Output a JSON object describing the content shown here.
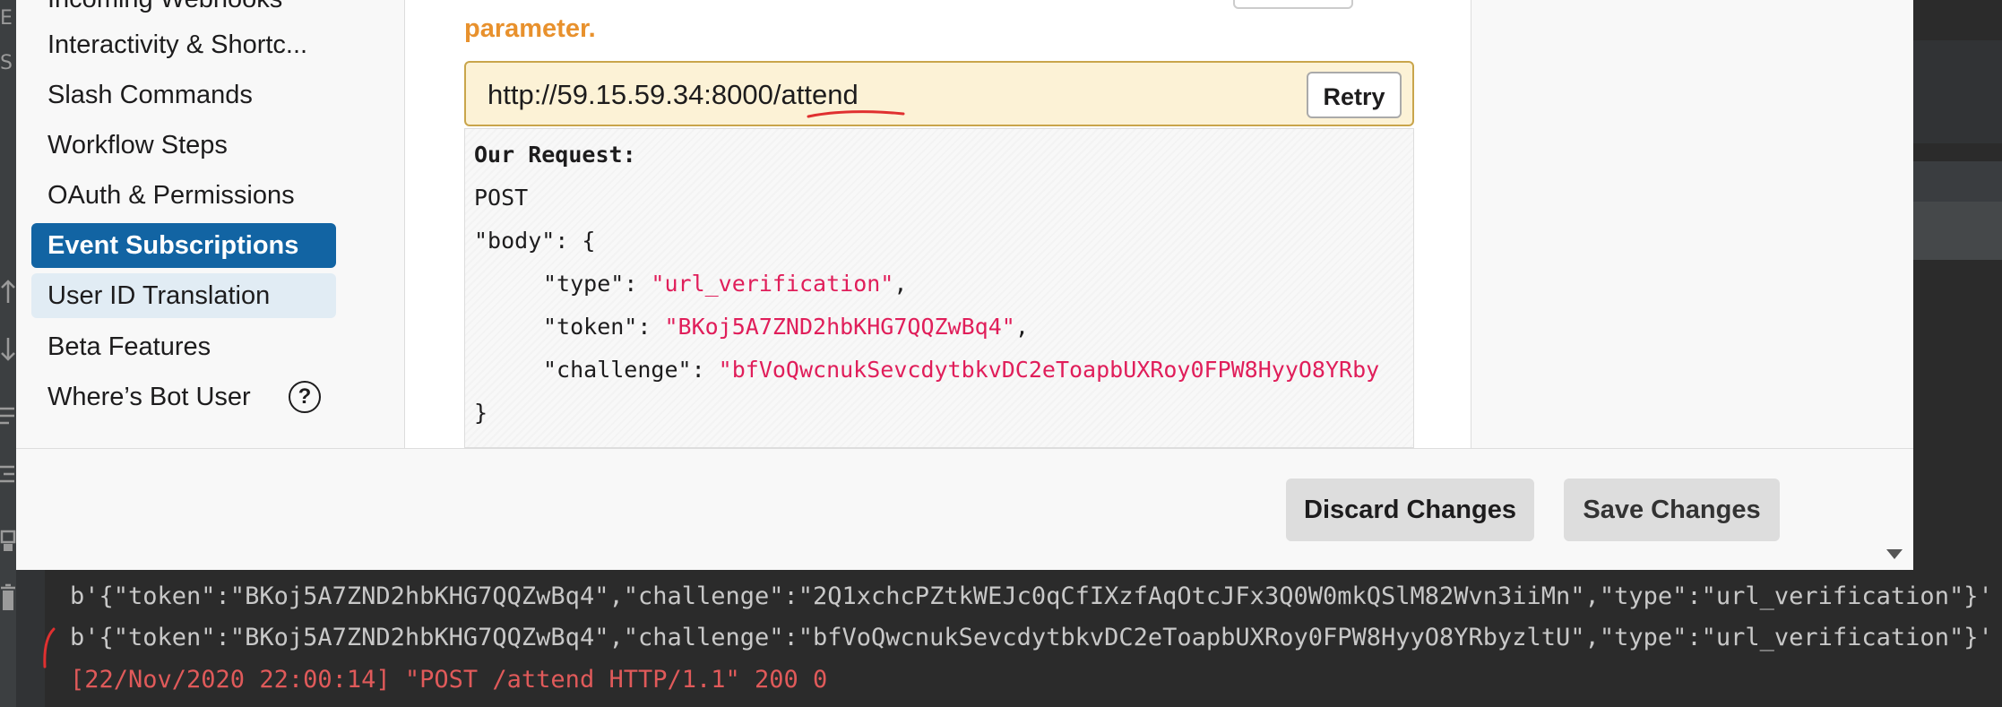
{
  "ide": {
    "left_glyphs": [
      "E",
      "S"
    ]
  },
  "sidebar": {
    "items": [
      {
        "label": "Incoming Webhooks"
      },
      {
        "label": "Interactivity & Shortc..."
      },
      {
        "label": "Slash Commands"
      },
      {
        "label": "Workflow Steps"
      },
      {
        "label": "OAuth & Permissions"
      },
      {
        "label": "Event Subscriptions",
        "state": "selected"
      },
      {
        "label": "User ID Translation",
        "state": "hover"
      },
      {
        "label": "Beta Features"
      },
      {
        "label": "Where’s Bot User"
      }
    ],
    "help_icon": "?"
  },
  "main": {
    "error_text": "parameter.",
    "request_url": "http://59.15.59.34:8000/attend",
    "retry_label": "Retry",
    "request": {
      "heading": "Our Request:",
      "method": "POST",
      "body_open": "\"body\": {",
      "fields": [
        {
          "key": "\"type\": ",
          "value": "\"url_verification\"",
          "suffix": ","
        },
        {
          "key": "\"token\": ",
          "value": "\"BKoj5A7ZND2hbKHG7QQZwBq4\"",
          "suffix": ","
        },
        {
          "key": "\"challenge\": ",
          "value": "\"bfVoQwcnukSevcdytbkvDC2eToapbUXRoy0FPW8HyyO8YRby",
          "suffix": ""
        }
      ],
      "body_close": "}"
    }
  },
  "footer": {
    "discard_label": "Discard Changes",
    "save_label": "Save Changes"
  },
  "terminal": {
    "lines": [
      "b'{\"token\":\"BKoj5A7ZND2hbKHG7QQZwBq4\",\"challenge\":\"2Q1xchcPZtkWEJc0qCfIXzfAqOtcJFx3Q0W0mkQSlM82Wvn3iiMn\",\"type\":\"url_verification\"}'",
      "b'{\"token\":\"BKoj5A7ZND2hbKHG7QQZwBq4\",\"challenge\":\"bfVoQwcnukSevcdytbkvDC2eToapbUXRoy0FPW8HyyO8YRbyzltU\",\"type\":\"url_verification\"}'",
      "[22/Nov/2020 22:00:14] \"POST /attend HTTP/1.1\" 200 0"
    ]
  },
  "colors": {
    "accent": "#1264a3",
    "error": "#e8912d",
    "string": "#e01e5a",
    "url_box": "#fcf2d6",
    "terminal_bg": "#2b2b2b",
    "log_red": "#e05a5a"
  }
}
